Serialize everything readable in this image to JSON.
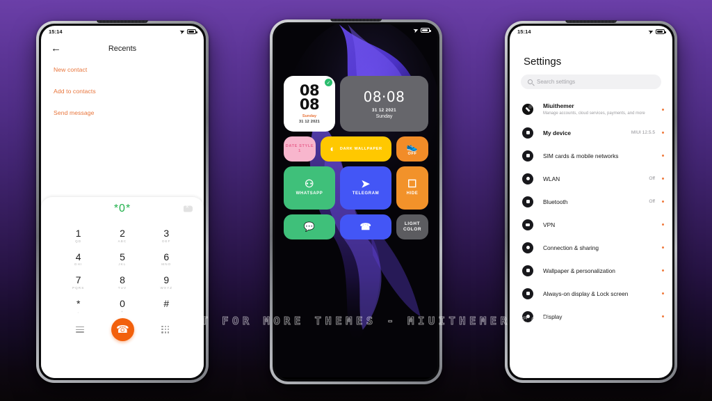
{
  "watermark": "VISIT FOR MORE THEMES - MIUITHEMER.COM",
  "colors": {
    "accent_orange": "#f2600c",
    "link_orange": "#e8743a",
    "dialer_green": "#22b14c",
    "dot_orange": "#ef7a3d",
    "background_purple": "#5c3596"
  },
  "phone_left": {
    "status": {
      "time": "15:14",
      "send_icon": "send-icon",
      "battery_icon": "battery-icon"
    },
    "header": {
      "back_icon": "back-arrow-icon",
      "title": "Recents"
    },
    "links": [
      "New contact",
      "Add to contacts",
      "Send message"
    ],
    "dialer": {
      "number": "*0*",
      "delete_icon": "backspace-icon",
      "keys": [
        {
          "digit": "1",
          "letters": "QD"
        },
        {
          "digit": "2",
          "letters": "ABC"
        },
        {
          "digit": "3",
          "letters": "DEF"
        },
        {
          "digit": "4",
          "letters": "GHI"
        },
        {
          "digit": "5",
          "letters": "JKL"
        },
        {
          "digit": "6",
          "letters": "MNO"
        },
        {
          "digit": "7",
          "letters": "PQRS"
        },
        {
          "digit": "8",
          "letters": "TUV"
        },
        {
          "digit": "9",
          "letters": "WXYZ"
        },
        {
          "digit": "*",
          "letters": ","
        },
        {
          "digit": "0",
          "letters": "+"
        },
        {
          "digit": "#",
          "letters": ""
        }
      ],
      "menu_icon": "hamburger-menu-icon",
      "call_icon": "phone-call-icon",
      "keypad_icon": "keypad-grid-icon"
    }
  },
  "phone_mid": {
    "status": {
      "time": "",
      "send_icon": "send-icon",
      "battery_icon": "battery-icon"
    },
    "widgets": {
      "clock_white": {
        "line1": "08",
        "line2": "08",
        "day": "Sunday",
        "date": "31 12 2021",
        "check_icon": "check-badge-icon"
      },
      "clock_grey": {
        "time": "08·08",
        "date": "31 12 2021",
        "day": "Sunday"
      }
    },
    "tiles_row1": [
      {
        "label": "DATE STYLE 1",
        "icon": "",
        "color": "#f8b6cd"
      },
      {
        "label": "DARK WALLPAPER",
        "icon": "contrast-circle-icon",
        "color": "#ffc800"
      },
      {
        "label": "OFF",
        "icon": "sneaker-icon",
        "color": "#f28c28"
      }
    ],
    "tiles_row2": [
      {
        "label": "WHATSAPP",
        "icon": "whatsapp-icon",
        "color": "#3fc07a"
      },
      {
        "label": "TELEGRAM",
        "icon": "telegram-icon",
        "color": "#4356f6"
      },
      {
        "label": "HIDE",
        "icon": "camera-icon",
        "color": "#f2922a"
      }
    ],
    "tiles_row3": [
      {
        "label": "",
        "icon": "wechat-icon",
        "color": "#3fc07a"
      },
      {
        "label": "",
        "icon": "phone-icon",
        "color": "#4356f6"
      },
      {
        "label": "LIGHT COLOR",
        "icon": "",
        "color": "#5c5c60"
      }
    ]
  },
  "phone_right": {
    "status": {
      "time": "15:14",
      "send_icon": "send-icon",
      "battery_icon": "battery-icon"
    },
    "title": "Settings",
    "search": {
      "placeholder": "Search settings",
      "icon": "search-icon"
    },
    "items": [
      {
        "label": "Miuithemer",
        "sub": "Manage accounts, cloud services, payments, and more",
        "value": "",
        "icon": "account-avatar-icon",
        "bold": true
      },
      {
        "label": "My device",
        "sub": "",
        "value": "MIUI 12.5.5",
        "icon": "device-icon",
        "bold": true
      },
      {
        "label": "SIM cards & mobile networks",
        "sub": "",
        "value": "",
        "icon": "sim-icon",
        "bold": false
      },
      {
        "label": "WLAN",
        "sub": "",
        "value": "Off",
        "icon": "wifi-icon",
        "bold": false
      },
      {
        "label": "Bluetooth",
        "sub": "",
        "value": "Off",
        "icon": "bluetooth-icon",
        "bold": false
      },
      {
        "label": "VPN",
        "sub": "",
        "value": "",
        "icon": "vpn-icon",
        "bold": false
      },
      {
        "label": "Connection & sharing",
        "sub": "",
        "value": "",
        "icon": "sharing-icon",
        "bold": false
      },
      {
        "label": "Wallpaper & personalization",
        "sub": "",
        "value": "",
        "icon": "wallpaper-icon",
        "bold": false
      },
      {
        "label": "Always-on display & Lock screen",
        "sub": "",
        "value": "",
        "icon": "lock-icon",
        "bold": false
      },
      {
        "label": "Display",
        "sub": "",
        "value": "",
        "icon": "display-icon",
        "bold": false
      }
    ]
  }
}
